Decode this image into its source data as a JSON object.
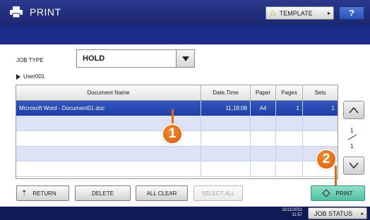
{
  "header": {
    "title": "PRINT",
    "template_label": "TEMPLATE",
    "help_label": "?"
  },
  "job_type": {
    "label": "JOB TYPE",
    "value": "HOLD"
  },
  "user": "User001",
  "table": {
    "columns": [
      "Document Name",
      "Date,Time",
      "Paper",
      "Pages",
      "Sets"
    ],
    "rows": [
      [
        "Microsoft Word - Document01.doc",
        "11,18:08",
        "A4",
        "1",
        "1"
      ],
      [
        "",
        "",
        "",
        "",
        ""
      ],
      [
        "",
        "",
        "",
        "",
        ""
      ],
      [
        "",
        "",
        "",
        "",
        ""
      ],
      [
        "",
        "",
        "",
        "",
        ""
      ]
    ]
  },
  "pagination": {
    "current": "1",
    "total": "1"
  },
  "callouts": [
    "1",
    "2"
  ],
  "buttons": {
    "return": "RETURN",
    "delete": "DELETE",
    "all_clear": "ALL CLEAR",
    "select_all": "SELECT ALL",
    "print": "PRINT"
  },
  "status": {
    "date": "11/11/2011",
    "time": "11:57",
    "job_status": "JOB STATUS"
  },
  "colors": {
    "header_bg": "#1b2670",
    "selected_row": "#2548b0",
    "alt_row": "#dde3f4",
    "callout": "#e06a14",
    "print_button": "#5cc6a7"
  }
}
